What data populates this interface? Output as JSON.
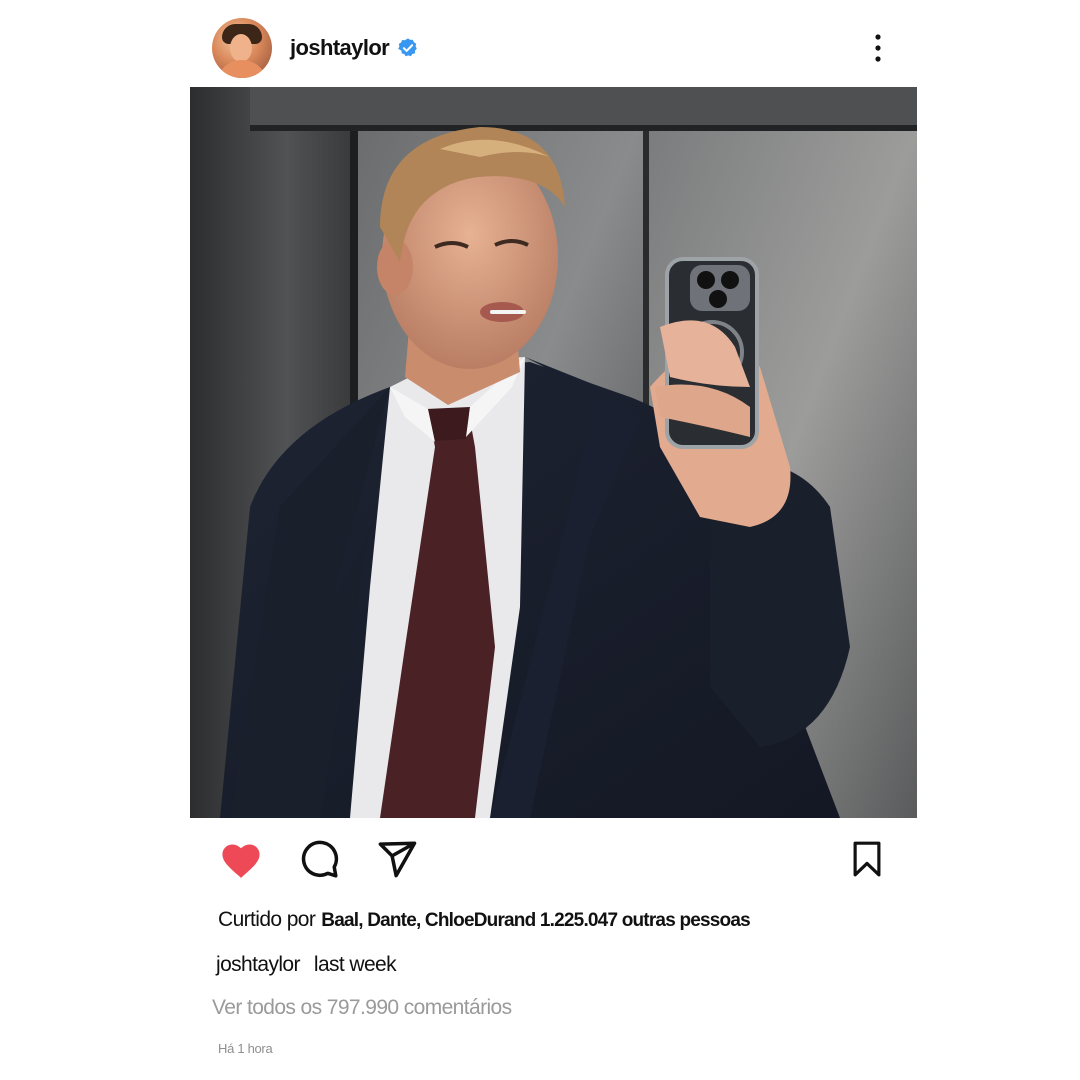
{
  "post": {
    "username": "joshtaylor",
    "verified": true,
    "avatar_icon": "profile-avatar",
    "more_icon": "more-vertical-icon",
    "photo_description_icon": "post-photo"
  },
  "actions": {
    "like_icon": "heart-icon",
    "liked": true,
    "like_color": "#ed4956",
    "comment_icon": "comment-icon",
    "share_icon": "send-icon",
    "save_icon": "bookmark-icon"
  },
  "likes": {
    "label": "Curtido por",
    "names": "Baal, Dante, ChloeDurand 1.225.047 outras pessoas"
  },
  "caption": {
    "username": "joshtaylor",
    "text": "last week"
  },
  "comments": {
    "link": "Ver todos os 797.990 comentários"
  },
  "timestamp": "Há 1 hora",
  "colors": {
    "verified_badge": "#3897f0",
    "muted_text": "#9a9a9a"
  }
}
